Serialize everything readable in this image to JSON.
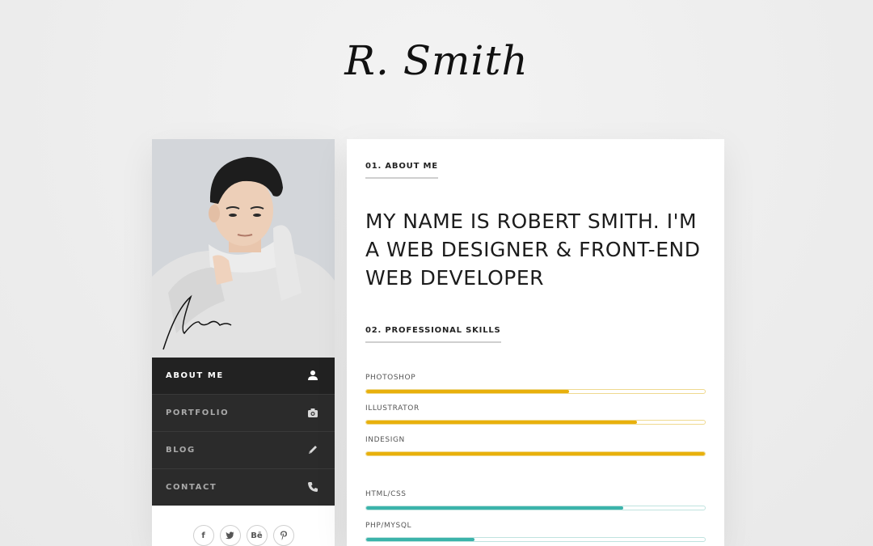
{
  "brand": {
    "logo_text": "R. Smith"
  },
  "sidebar": {
    "nav": [
      {
        "label": "ABOUT ME",
        "icon": "user-icon",
        "active": true
      },
      {
        "label": "PORTFOLIO",
        "icon": "camera-icon",
        "active": false
      },
      {
        "label": "BLOG",
        "icon": "pencil-icon",
        "active": false
      },
      {
        "label": "CONTACT",
        "icon": "phone-icon",
        "active": false
      }
    ],
    "social": [
      {
        "label": "f",
        "icon": "facebook-icon"
      },
      {
        "label": "🐦",
        "icon": "twitter-icon"
      },
      {
        "label": "Bē",
        "icon": "behance-icon"
      },
      {
        "label": "℗",
        "icon": "pinterest-icon"
      }
    ]
  },
  "about": {
    "heading": "01. ABOUT ME",
    "headline": "MY NAME IS ROBERT SMITH. I'M A WEB DESIGNER & FRONT-END WEB DEVELOPER"
  },
  "skills": {
    "heading": "02. PROFESSIONAL SKILLS",
    "items": [
      {
        "name": "PHOTOSHOP",
        "percent": 60,
        "color": "#e8b00c",
        "track": "#efd98f"
      },
      {
        "name": "ILLUSTRATOR",
        "percent": 80,
        "color": "#e8b00c",
        "track": "#efd98f"
      },
      {
        "name": "INDESIGN",
        "percent": 100,
        "color": "#e8b00c",
        "track": "#efd98f"
      },
      {
        "name": "HTML/CSS",
        "percent": 76,
        "color": "#3bb3aa",
        "track": "#bfe3df"
      },
      {
        "name": "PHP/MYSQL",
        "percent": 32,
        "color": "#3bb3aa",
        "track": "#bfe3df"
      }
    ]
  },
  "colors": {
    "accent_yellow": "#e8b00c",
    "accent_teal": "#3bb3aa",
    "nav_bg": "#2b2b2b"
  }
}
